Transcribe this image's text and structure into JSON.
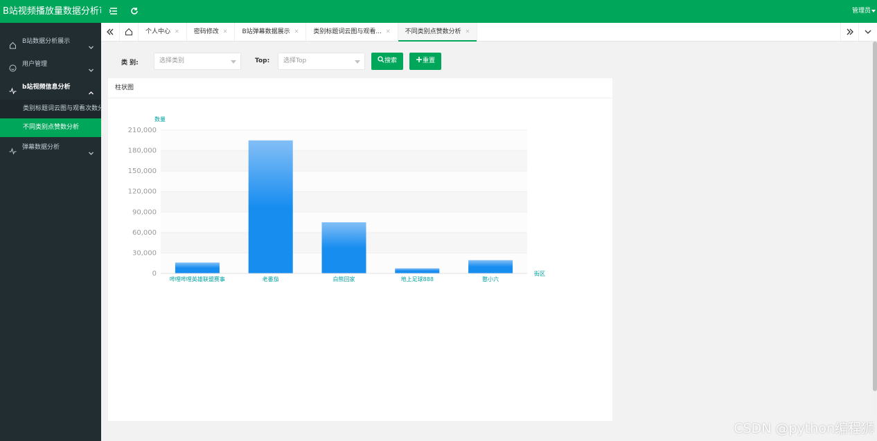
{
  "app": {
    "title": "B站视频播放量数据分析可视化",
    "user": "管理员"
  },
  "sidebar": {
    "items": [
      {
        "label": "B站数据分析展示"
      },
      {
        "label": "用户管理"
      },
      {
        "label": "b站视频信息分析",
        "children": [
          {
            "label": "类别标题词云图与观看次数分析"
          },
          {
            "label": "不同类别点赞数分析"
          }
        ]
      },
      {
        "label": "弹幕数据分析"
      }
    ]
  },
  "tabs": [
    {
      "label": "个人中心"
    },
    {
      "label": "密码修改"
    },
    {
      "label": "B站弹幕数据展示"
    },
    {
      "label": "类别标题词云图与观看..."
    },
    {
      "label": "不同类别点赞数分析"
    }
  ],
  "filters": {
    "category_label": "类  别:",
    "category_placeholder": "选择类别",
    "top_label": "Top:",
    "top_placeholder": "选择Top",
    "search_label": "搜索",
    "reset_label": "重置"
  },
  "panel": {
    "title": "柱状图"
  },
  "chart_data": {
    "type": "bar",
    "ylabel": "数量",
    "xlabel": "街区",
    "categories": [
      "哔哩哔哩英雄联盟赛事",
      "老番茄",
      "白熊回家",
      "地上足球888",
      "憨小六"
    ],
    "values": [
      16000,
      195000,
      75000,
      7500,
      19500
    ],
    "ylim": [
      0,
      210000
    ],
    "yticks": [
      "210,000",
      "180,000",
      "150,000",
      "120,000",
      "90,000",
      "60,000",
      "30,000",
      "0"
    ],
    "grid": true,
    "colors": {
      "bar_top": "#83bff6",
      "bar_bottom": "#188df0",
      "axis_label": "#00a0a0",
      "tick_label": "#999999"
    }
  },
  "watermark": "CSDN @python编程狮"
}
